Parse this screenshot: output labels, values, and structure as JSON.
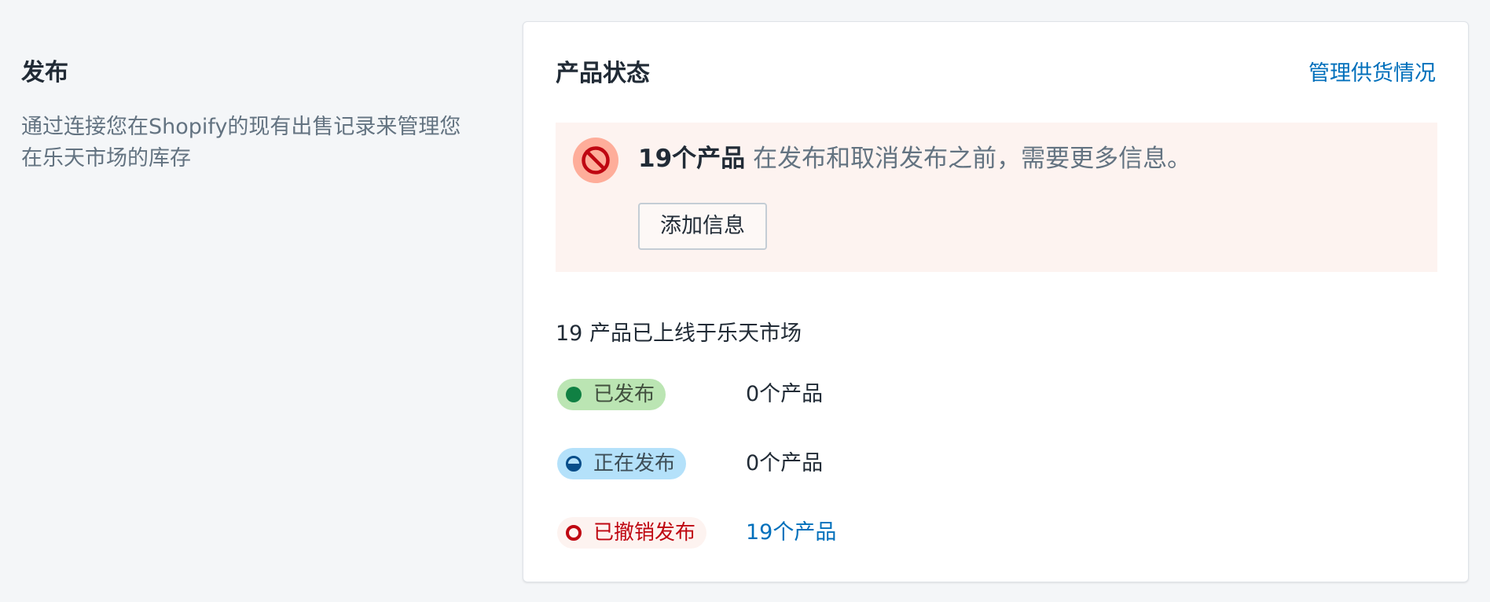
{
  "section": {
    "title": "发布",
    "description": "通过连接您在Shopify的现有出售记录来管理您在乐天市场的库存"
  },
  "card": {
    "title": "产品状态",
    "manage_link": "管理供货情况",
    "banner": {
      "icon": "prohibited-icon",
      "count_text": "19个产品",
      "message": "在发布和取消发布之前，需要更多信息。",
      "button_label": "添加信息",
      "colors": {
        "background": "#fdf3f0",
        "icon_ring": "#fead9a",
        "icon": "#bf0711"
      }
    },
    "live_summary": "19 产品已上线于乐天市场",
    "statuses": [
      {
        "label": "已发布",
        "count": "0个产品",
        "color": "#108043",
        "badge_bg": "#bbe5b3"
      },
      {
        "label": "正在发布",
        "count": "0个产品",
        "color": "#084e8a",
        "badge_bg": "#b4e1fa"
      },
      {
        "label": "已撤销发布",
        "count": "19个产品",
        "color": "#bf0711",
        "badge_bg": "#fdf3f0"
      }
    ]
  },
  "colors": {
    "link": "#006fbb",
    "page_bg": "#f4f6f8"
  }
}
